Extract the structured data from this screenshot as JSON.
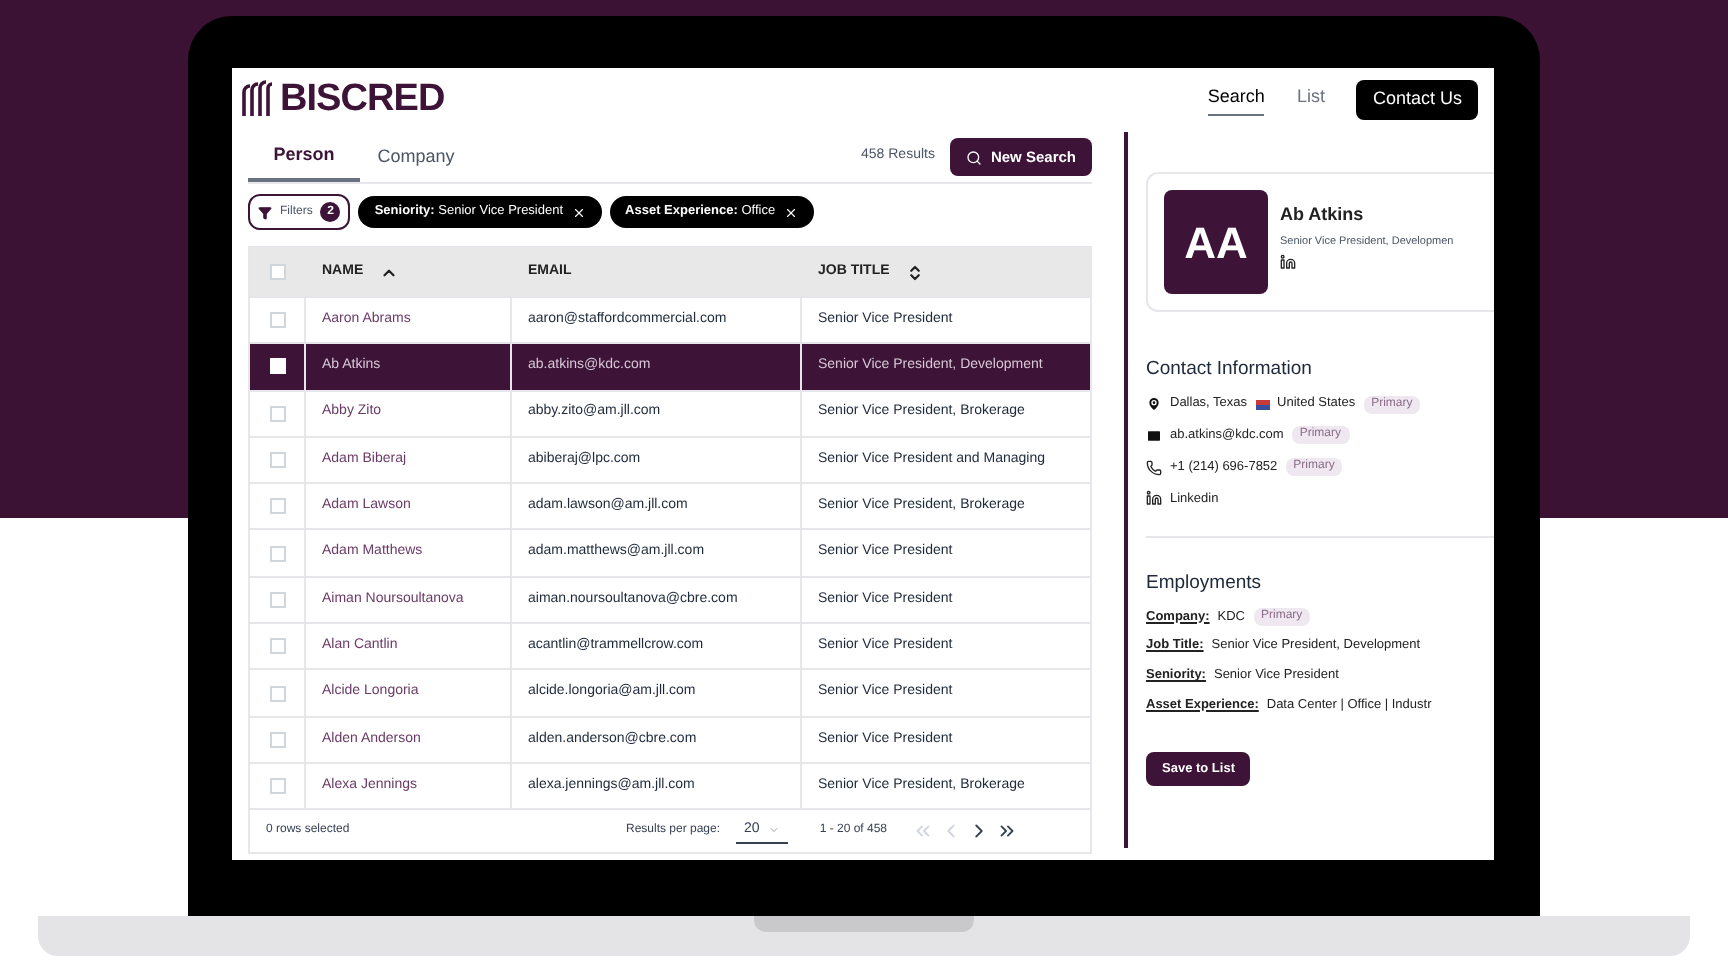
{
  "brand": {
    "name": "BISCRED"
  },
  "nav": [
    {
      "label": "Search",
      "selected": true
    },
    {
      "label": "List",
      "selected": false
    }
  ],
  "contact_button": "Contact Us",
  "tabs": [
    {
      "label": "Person",
      "selected": true
    },
    {
      "label": "Company",
      "selected": false
    }
  ],
  "results_count": "458 Results",
  "new_search_button": "New Search",
  "filters": {
    "label": "Filters",
    "count": "2"
  },
  "filter_chips": [
    {
      "key": "Seniority:",
      "value": "Senior Vice President"
    },
    {
      "key": "Asset Experience:",
      "value": "Office"
    }
  ],
  "table": {
    "all_selected": false,
    "columns": [
      {
        "label": "NAME",
        "kind": "sorted-ascending"
      },
      {
        "label": "EMAIL",
        "kind": "plain"
      },
      {
        "label": "JOB TITLE",
        "kind": "sortable"
      }
    ],
    "rows": [
      {
        "name": "Aaron Abrams",
        "email": "aaron@staffordcommercial.com",
        "job_title": "Senior Vice President",
        "selected": false
      },
      {
        "name": "Ab Atkins",
        "email": "ab.atkins@kdc.com",
        "job_title": "Senior Vice President, Development",
        "selected": true
      },
      {
        "name": "Abby Zito",
        "email": "abby.zito@am.jll.com",
        "job_title": "Senior Vice President, Brokerage",
        "selected": false
      },
      {
        "name": "Adam Biberaj",
        "email": "abiberaj@lpc.com",
        "job_title": "Senior Vice President and Managing",
        "selected": false
      },
      {
        "name": "Adam Lawson",
        "email": "adam.lawson@am.jll.com",
        "job_title": "Senior Vice President, Brokerage",
        "selected": false
      },
      {
        "name": "Adam Matthews",
        "email": "adam.matthews@am.jll.com",
        "job_title": "Senior Vice President",
        "selected": false
      },
      {
        "name": "Aiman Noursoultanova",
        "email": "aiman.noursoultanova@cbre.com",
        "job_title": "Senior Vice President",
        "selected": false
      },
      {
        "name": "Alan Cantlin",
        "email": "acantlin@trammellcrow.com",
        "job_title": "Senior Vice President",
        "selected": false
      },
      {
        "name": "Alcide Longoria",
        "email": "alcide.longoria@am.jll.com",
        "job_title": "Senior Vice President",
        "selected": false
      },
      {
        "name": "Alden Anderson",
        "email": "alden.anderson@cbre.com",
        "job_title": "Senior Vice President",
        "selected": false
      },
      {
        "name": "Alexa Jennings",
        "email": "alexa.jennings@am.jll.com",
        "job_title": "Senior Vice President, Brokerage",
        "selected": false
      }
    ]
  },
  "footer": {
    "selected_count": "0 rows selected",
    "per_page_label": "Results per page:",
    "per_page": "20",
    "range": "1 - 20 of 458"
  },
  "pagination": [
    {
      "kind": "first",
      "disabled": true
    },
    {
      "kind": "prev",
      "disabled": true
    },
    {
      "kind": "next",
      "disabled": false
    },
    {
      "kind": "last",
      "disabled": false
    }
  ],
  "profile": {
    "initials": "AA",
    "name": "Ab Atkins",
    "title": "Senior Vice President, Developmen"
  },
  "contact": {
    "heading": "Contact Information",
    "items": [
      {
        "kind": "location",
        "text": "Dallas, Texas",
        "country": "United States",
        "badge": "Primary"
      },
      {
        "kind": "email",
        "text": "ab.atkins@kdc.com",
        "badge": "Primary"
      },
      {
        "kind": "phone",
        "text": "+1 (214) 696-7852",
        "badge": "Primary"
      },
      {
        "kind": "linkedin",
        "text": "Linkedin"
      }
    ]
  },
  "employments": {
    "heading": "Employments",
    "fields": [
      {
        "label": "Company:",
        "value": "KDC",
        "badge": "Primary"
      },
      {
        "label": "Job Title:",
        "value": "Senior Vice President, Development"
      },
      {
        "label": "Seniority:",
        "value": "Senior Vice President"
      },
      {
        "label": "Asset Experience:",
        "value": "Data Center | Office | Industr"
      }
    ]
  },
  "save_button": "Save to List"
}
